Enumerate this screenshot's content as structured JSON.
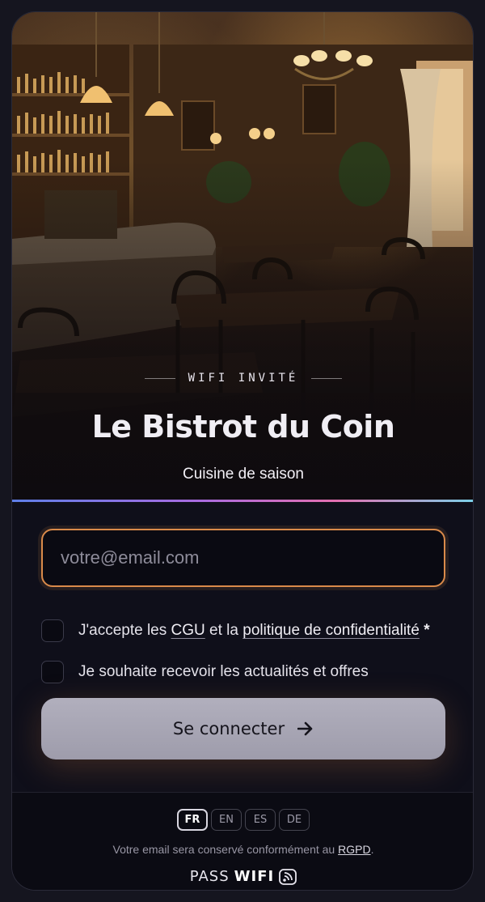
{
  "hero": {
    "eyebrow": "WIFI INVITÉ",
    "title": "Le Bistrot du Coin",
    "subtitle": "Cuisine de saison",
    "image": "bistro-interior-photo"
  },
  "form": {
    "email_placeholder": "votre@email.com",
    "email_value": "",
    "consent": {
      "prefix": "J'accepte les ",
      "cgu_link": "CGU",
      "middle": " et la ",
      "privacy_link": "politique de confidentialité",
      "required_mark": " *",
      "checked": false
    },
    "newsletter": {
      "label": "Je souhaite recevoir les actualités et offres",
      "checked": false
    },
    "submit_label": "Se connecter",
    "submit_icon": "arrow-right-icon"
  },
  "footer": {
    "languages": [
      "FR",
      "EN",
      "ES",
      "DE"
    ],
    "active_language": "FR",
    "note_prefix": "Votre email sera conservé conformément au ",
    "note_link": "RGPD",
    "note_suffix": ".",
    "brand_light": "PASS",
    "brand_bold": "WIFI",
    "brand_icon": "wifi-icon"
  },
  "colors": {
    "accent_orange": "#d98a4a",
    "button_bg": "#a9a7b6",
    "background": "#0f0f1a"
  }
}
